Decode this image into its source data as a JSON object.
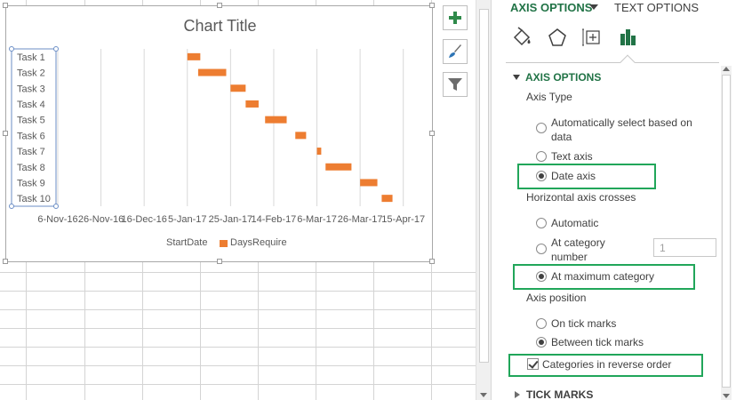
{
  "chart": {
    "title": "Chart Title",
    "legend": [
      {
        "label": "StartDate",
        "color": ""
      },
      {
        "label": "DaysRequire",
        "color": "#ed7d31"
      }
    ]
  },
  "chart_data": {
    "type": "bar",
    "orientation": "horizontal",
    "title": "Chart Title",
    "categories": [
      "Task 1",
      "Task 2",
      "Task 3",
      "Task 4",
      "Task 5",
      "Task 6",
      "Task 7",
      "Task 8",
      "Task 9",
      "Task 10"
    ],
    "x_axis_type": "date",
    "x_ticks": [
      "6-Nov-16",
      "26-Nov-16",
      "16-Dec-16",
      "5-Jan-17",
      "25-Jan-17",
      "14-Feb-17",
      "6-Mar-17",
      "26-Mar-17",
      "15-Apr-17"
    ],
    "xlim": [
      "2016-11-06",
      "2017-04-25"
    ],
    "series": [
      {
        "name": "StartDate",
        "color": "none",
        "values": [
          "2017-01-05",
          "2017-01-10",
          "2017-01-25",
          "2017-02-01",
          "2017-02-10",
          "2017-02-24",
          "2017-03-06",
          "2017-03-10",
          "2017-03-26",
          "2017-04-05"
        ]
      },
      {
        "name": "DaysRequire",
        "color": "#ed7d31",
        "values": [
          6,
          13,
          7,
          6,
          10,
          5,
          2,
          12,
          8,
          5
        ]
      }
    ],
    "grid": "vertical",
    "legend_position": "bottom",
    "categories_reversed": true
  },
  "pane": {
    "tab_axis": "AXIS OPTIONS",
    "tab_text": "TEXT OPTIONS",
    "section_axis": "AXIS OPTIONS",
    "axis_type_label": "Axis Type",
    "opt_auto": "Automatically select based on",
    "opt_auto2": "data",
    "opt_text": "Text axis",
    "opt_date": "Date axis",
    "crosses_label": "Horizontal axis crosses",
    "opt_automatic": "Automatic",
    "opt_at_cat": "At category",
    "opt_at_cat2": "number",
    "at_cat_value": "1",
    "opt_max_cat": "At maximum category",
    "axis_position_label": "Axis position",
    "opt_on_tick": "On tick marks",
    "opt_between": "Between tick marks",
    "opt_reverse": "Categories in reverse order",
    "section_tick": "TICK MARKS"
  },
  "colors": {
    "accent": "#217346",
    "bar": "#ed7d31",
    "highlight": "#21a65a"
  }
}
